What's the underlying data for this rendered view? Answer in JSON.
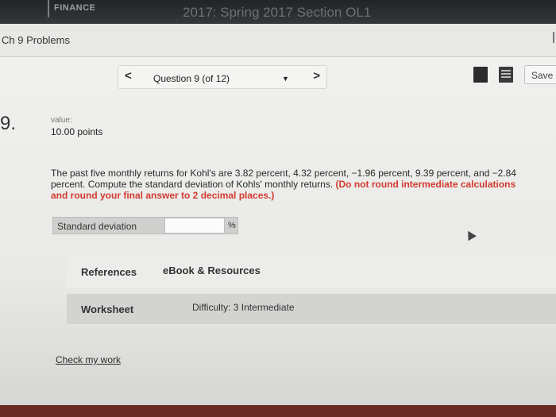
{
  "app": {
    "brand": "FINANCE",
    "course_title": "2017: Spring 2017 Section OL1"
  },
  "subheader": {
    "title": "Ch 9 Problems"
  },
  "question_nav": {
    "prev_glyph": "<",
    "label": "Question 9 (of 12)",
    "caret_glyph": "▼",
    "next_glyph": ">"
  },
  "toolbar": {
    "save_label": "Save",
    "icons": [
      "book-icon",
      "print-icon"
    ]
  },
  "question": {
    "number": "9.",
    "value_label": "value:",
    "points": "10.00 points",
    "text": "The past five monthly returns for Kohl's are 3.82 percent, 4.32 percent, −1.96 percent, 9.39 percent, and −2.84 percent. Compute the standard deviation of Kohls' monthly returns.",
    "instruction": "(Do not round intermediate calculations and round your final answer to 2 decimal places.)"
  },
  "answer": {
    "label": "Standard deviation",
    "value": "",
    "unit": "%"
  },
  "tabs": {
    "references": "References",
    "ebook": "eBook & Resources",
    "worksheet": "Worksheet",
    "difficulty": "Difficulty: 3 Intermediate"
  },
  "links": {
    "check_work": "Check my work"
  }
}
